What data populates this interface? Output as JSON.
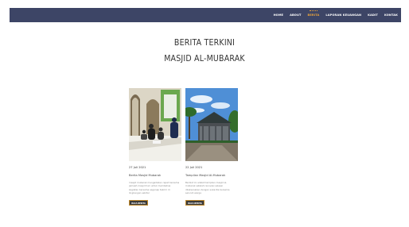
{
  "nav": {
    "items": [
      {
        "label": "HOME",
        "active": false
      },
      {
        "label": "ABOUT",
        "active": false
      },
      {
        "label": "BERITA",
        "active": true
      },
      {
        "label": "LAPORAN KEUANGAN",
        "active": false
      },
      {
        "label": "KADIT",
        "active": false
      },
      {
        "label": "KONTAK",
        "active": false
      }
    ]
  },
  "header": {
    "line1": "BERITA TERKINI",
    "line2": "MASJID AL-MUBARAK"
  },
  "cards": [
    {
      "date": "27 Juli 2021",
      "title": "Berita Masjid Mubarak",
      "excerpt": "masjid mubarak mengadakan rapat bersama jamaah masjid hari untuk membahas kegiatan bersama segenap takmir di lingkungan sekitar",
      "button": "BACA BERITA"
    },
    {
      "date": "22 Juli 2021",
      "title": "Tampilan Masjid Al-Mubarak",
      "excerpt": "Berikut ini adalah tampilan masjid al-mubarak setelah renovasi selesai dilaksanakan dengan sukacita bersama seluruh warga",
      "button": "BACA BERITA"
    }
  ],
  "colors": {
    "navbar": "#3d4566",
    "active_nav": "#e8a33d",
    "button": "#3a3a3a"
  }
}
